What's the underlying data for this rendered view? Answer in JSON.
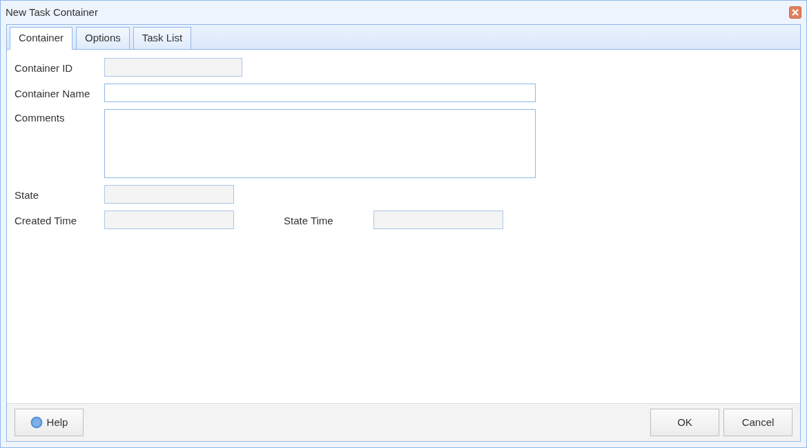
{
  "window": {
    "title": "New Task Container"
  },
  "tabs": [
    {
      "label": "Container",
      "selected": true
    },
    {
      "label": "Options",
      "selected": false
    },
    {
      "label": "Task List",
      "selected": false
    }
  ],
  "form": {
    "rows": [
      [
        {
          "label": "Container ID",
          "kind": "input",
          "readonly": true
        }
      ],
      [
        {
          "label": "Container Name",
          "kind": "input",
          "readonly": false
        }
      ],
      [
        {
          "label": "Comments",
          "kind": "textarea",
          "readonly": false
        }
      ],
      [
        {
          "label": "State",
          "kind": "input",
          "readonly": true
        }
      ],
      [
        {
          "label": "Created Time",
          "kind": "input",
          "readonly": true
        },
        {
          "label": "State Time",
          "kind": "input",
          "readonly": true
        }
      ]
    ]
  },
  "buttons": {
    "left": [
      {
        "label": "Help"
      }
    ],
    "right": [
      {
        "label": "OK"
      },
      {
        "label": "Cancel"
      }
    ]
  }
}
